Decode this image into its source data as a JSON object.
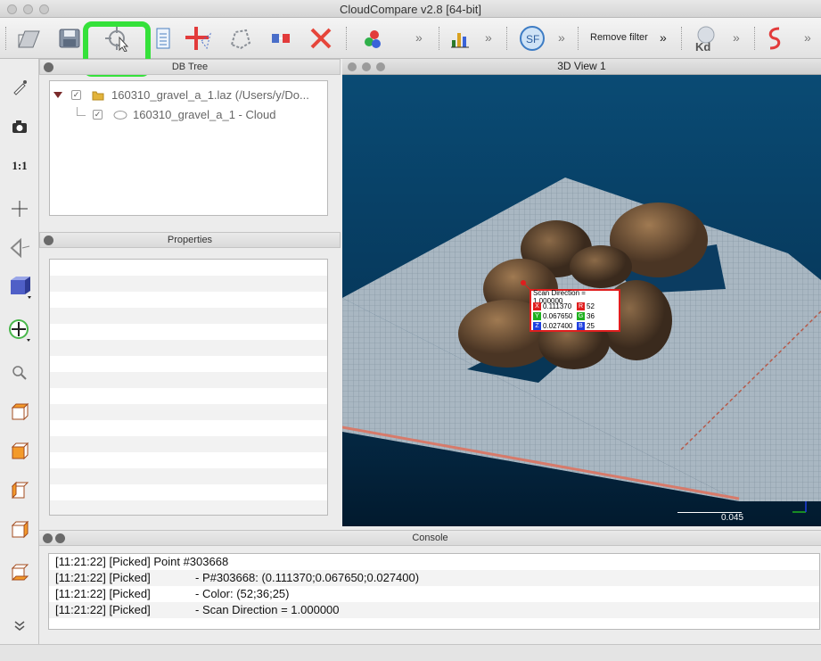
{
  "window": {
    "title": "CloudCompare v2.8 [64-bit]"
  },
  "toolbar": {
    "remove_filter_label": "Remove filter",
    "chevron": "»",
    "icons": [
      "open-icon",
      "save-icon",
      "point-picking-icon",
      "list-icon",
      "add-point-icon",
      "segment-icon",
      "merge-icon",
      "delete-icon",
      "color-icon",
      "histogram-icon",
      "sf-icon",
      "kd-icon",
      "s-curve-icon"
    ]
  },
  "db_tree": {
    "title": "DB Tree",
    "items": [
      {
        "label": "160310_gravel_a_1.laz (/Users/y/Do...",
        "checked": "✓"
      },
      {
        "label": "160310_gravel_a_1 - Cloud",
        "checked": "✓"
      }
    ]
  },
  "properties": {
    "title": "Properties"
  },
  "view3d": {
    "title": "3D View 1",
    "pick_label": {
      "header": "Scan Direction = 1.000000",
      "rows": [
        {
          "axis": "X",
          "value": "0.111370",
          "channel": "R",
          "channel_value": "52"
        },
        {
          "axis": "Y",
          "value": "0.067650",
          "channel": "G",
          "channel_value": "36"
        },
        {
          "axis": "Z",
          "value": "0.027400",
          "channel": "B",
          "channel_value": "25"
        }
      ]
    },
    "scale_label": "0.045"
  },
  "console": {
    "title": "Console",
    "lines": [
      {
        "prefix": "[11:21:22] [Picked] Point #303668",
        "msg": ""
      },
      {
        "prefix": "[11:21:22] [Picked]",
        "msg": "- P#303668: (0.111370;0.067650;0.027400)"
      },
      {
        "prefix": "[11:21:22] [Picked]",
        "msg": "- Color: (52;36;25)"
      },
      {
        "prefix": "[11:21:22] [Picked]",
        "msg": "- Scan Direction = 1.000000"
      }
    ]
  },
  "left_toolbar": {
    "ratio_label": "1:1"
  },
  "colors": {
    "highlight": "#35e13a",
    "pick_border": "#e01e1e",
    "axis_x": "#e01e1e",
    "axis_y": "#1fb01f",
    "axis_z": "#1e3fe0"
  }
}
